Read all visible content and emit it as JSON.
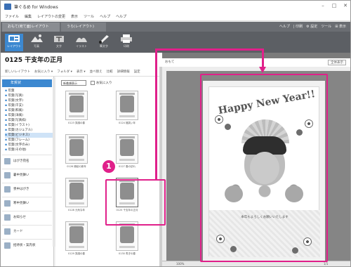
{
  "window": {
    "title": "筆ぐるめ for Windows",
    "controls": {
      "minimize": "–",
      "maximize": "□",
      "close": "✕"
    }
  },
  "menu": [
    "ファイル",
    "編集",
    "レイアウトの変更",
    "表示",
    "ツール",
    "ヘルプ",
    "ヘルプ"
  ],
  "tabs": [
    "おもて(宛て面)レイアウト",
    "うら(レイアウト)"
  ],
  "right_links": "ヘルプ　| 印刷　⚙ 設定　ツール　⊞ 表示",
  "toolbar": [
    {
      "label": "レイアウト",
      "icon": "layout-icon",
      "active": true
    },
    {
      "label": "写真",
      "icon": "photo-icon",
      "active": false
    },
    {
      "label": "文字",
      "icon": "text-icon",
      "active": false
    },
    {
      "label": "イラスト",
      "icon": "illustration-icon",
      "active": false
    },
    {
      "label": "筆文字",
      "icon": "brush-icon",
      "active": false
    },
    {
      "label": "印刷",
      "icon": "print-icon",
      "active": false
    }
  ],
  "header": {
    "title": "0125 干支年の正月"
  },
  "subbar": [
    "新しいレイアウト",
    "お気に入り ▾",
    "フォルダ ▾",
    "表示 ▾",
    "並べ替え",
    "比較",
    "詳細情報",
    "設定"
  ],
  "nav": {
    "head": "年賀状",
    "items": [
      "年賀",
      "年賀(写真)",
      "年賀(文字)",
      "年賀(干支)",
      "年賀(和風)",
      "年賀(洋風)",
      "年賀(写真枠)",
      "年賀(イラスト)",
      "年賀(カジュアル)",
      "年賀(ビジネス)",
      "年賀(フレーム)",
      "年賀(文字のみ)",
      "年賀(その他)"
    ],
    "selected_index": 9,
    "groups": [
      "はがき宛名",
      "暑中見舞い",
      "喪中はがき",
      "寒中見舞い",
      "お知らせ",
      "カード",
      "招待状・案内状"
    ]
  },
  "thumb_panel": {
    "sort_label": "新着順表示",
    "checkbox_label": "お気に入り"
  },
  "thumbnails": [
    {
      "caption": "0123 笑顔の春",
      "highlighted": false
    },
    {
      "caption": "0124 福笑い年",
      "highlighted": false
    },
    {
      "caption": "0126 縁起の新年",
      "highlighted": false
    },
    {
      "caption": "0127 春の訪れ",
      "highlighted": false
    },
    {
      "caption": "0128 元気な年",
      "highlighted": false
    },
    {
      "caption": "0125 干支年の正月",
      "highlighted": true
    },
    {
      "caption": "0129 笑顔の春",
      "highlighted": false
    },
    {
      "caption": "0130 寿ぎの春",
      "highlighted": false
    }
  ],
  "canvas": {
    "label": "おもて",
    "button": "全体表示",
    "card_title": "Happy New Year!!",
    "greeting": "本年もよろしくお願いいたします"
  },
  "callout": {
    "number": "1",
    "color": "#e0208a"
  },
  "status": {
    "zoom": "100%",
    "page": "1/1"
  }
}
